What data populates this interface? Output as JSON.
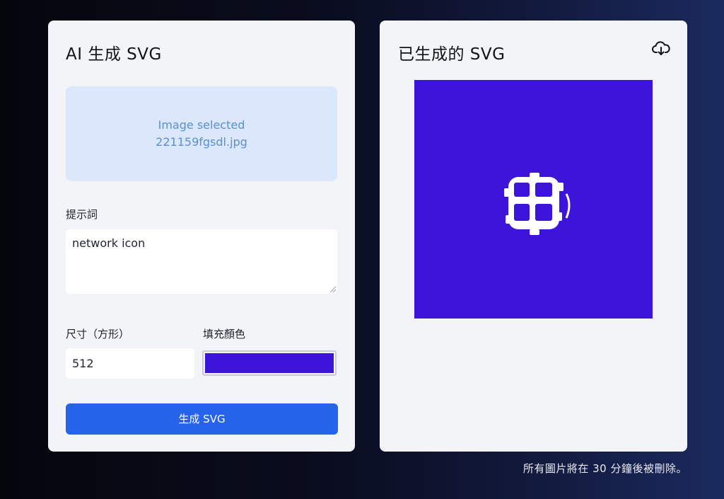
{
  "left_panel": {
    "title": "AI 生成 SVG",
    "upload": {
      "status": "Image selected",
      "filename": "221159fgsdl.jpg"
    },
    "prompt_label": "提示詞",
    "prompt_value": "network icon",
    "size_label": "尺寸（方形）",
    "size_value": "512",
    "color_label": "填充顏色",
    "fill_color": "#3d14d9",
    "generate_label": "生成 SVG"
  },
  "right_panel": {
    "title": "已生成的 SVG",
    "download_icon": "cloud-download-icon",
    "preview_background": "#3d14d9",
    "preview_icon": "network-globe-icon",
    "preview_icon_color": "#ffffff"
  },
  "footer": {
    "note": "所有圖片將在 30 分鐘後被刪除。"
  },
  "colors": {
    "card_bg": "#f2f4f7",
    "upload_bg": "#dbe8fb",
    "upload_text": "#5b8fd1",
    "button_bg": "#2563eb"
  }
}
